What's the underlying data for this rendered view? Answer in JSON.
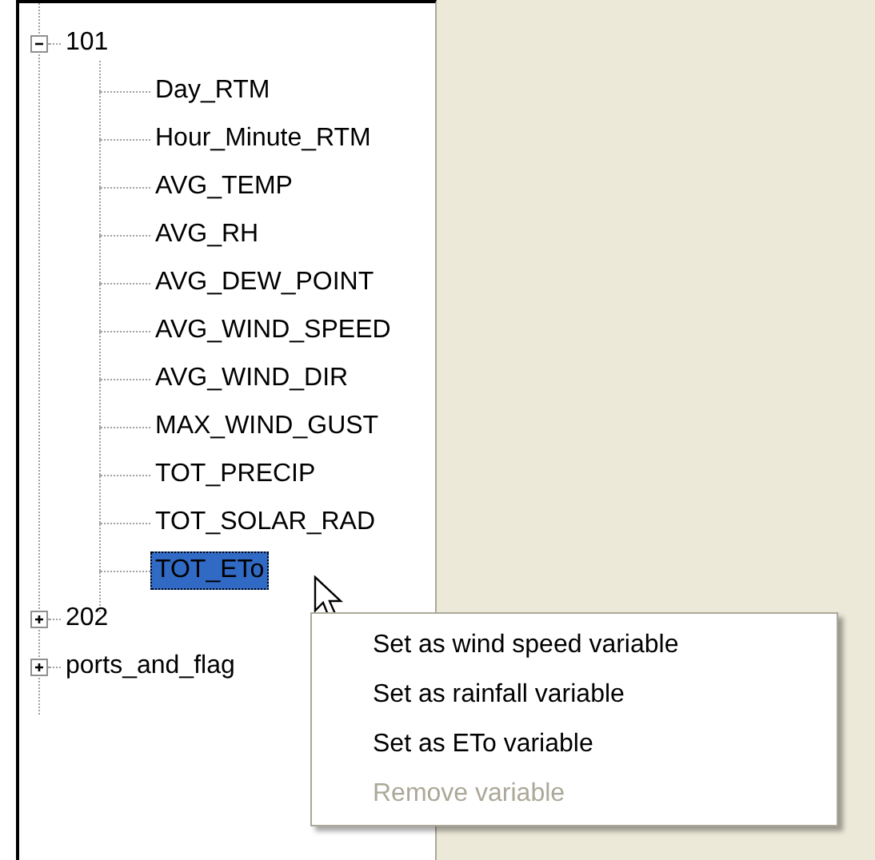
{
  "tree": [
    {
      "label": "101",
      "expanded": true,
      "selected": false,
      "children": [
        {
          "label": "Day_RTM",
          "selected": false
        },
        {
          "label": "Hour_Minute_RTM",
          "selected": false
        },
        {
          "label": "AVG_TEMP",
          "selected": false
        },
        {
          "label": "AVG_RH",
          "selected": false
        },
        {
          "label": "AVG_DEW_POINT",
          "selected": false
        },
        {
          "label": "AVG_WIND_SPEED",
          "selected": false
        },
        {
          "label": "AVG_WIND_DIR",
          "selected": false
        },
        {
          "label": "MAX_WIND_GUST",
          "selected": false
        },
        {
          "label": "TOT_PRECIP",
          "selected": false
        },
        {
          "label": "TOT_SOLAR_RAD",
          "selected": false
        },
        {
          "label": "TOT_ETo",
          "selected": true
        }
      ]
    },
    {
      "label": "202",
      "expanded": false,
      "selected": false
    },
    {
      "label": "ports_and_flag",
      "expanded": false,
      "selected": false
    }
  ],
  "context_menu": [
    {
      "label": "Set as wind speed variable",
      "disabled": false
    },
    {
      "label": "Set as rainfall variable",
      "disabled": false
    },
    {
      "label": "Set as ETo variable",
      "disabled": false
    },
    {
      "label": "Remove variable",
      "disabled": true
    }
  ]
}
